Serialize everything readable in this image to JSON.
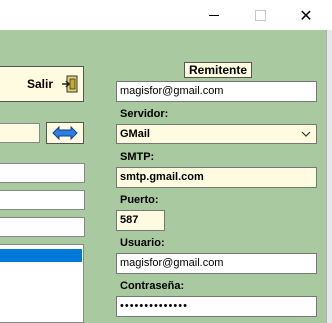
{
  "window": {
    "controls": {
      "close": "✕"
    }
  },
  "left_panel": {
    "exit_button_label": "Salir"
  },
  "remitente": {
    "header": "Remitente",
    "from_email": "magisfor@gmail.com",
    "server_label": "Servidor:",
    "server_value": "GMail",
    "smtp_label": "SMTP:",
    "smtp_value": "smtp.gmail.com",
    "port_label": "Puerto:",
    "port_value": "587",
    "user_label": "Usuario:",
    "user_value": "magisfor@gmail.com",
    "password_label": "Contraseña:",
    "password_value": "••••••••••••••"
  }
}
